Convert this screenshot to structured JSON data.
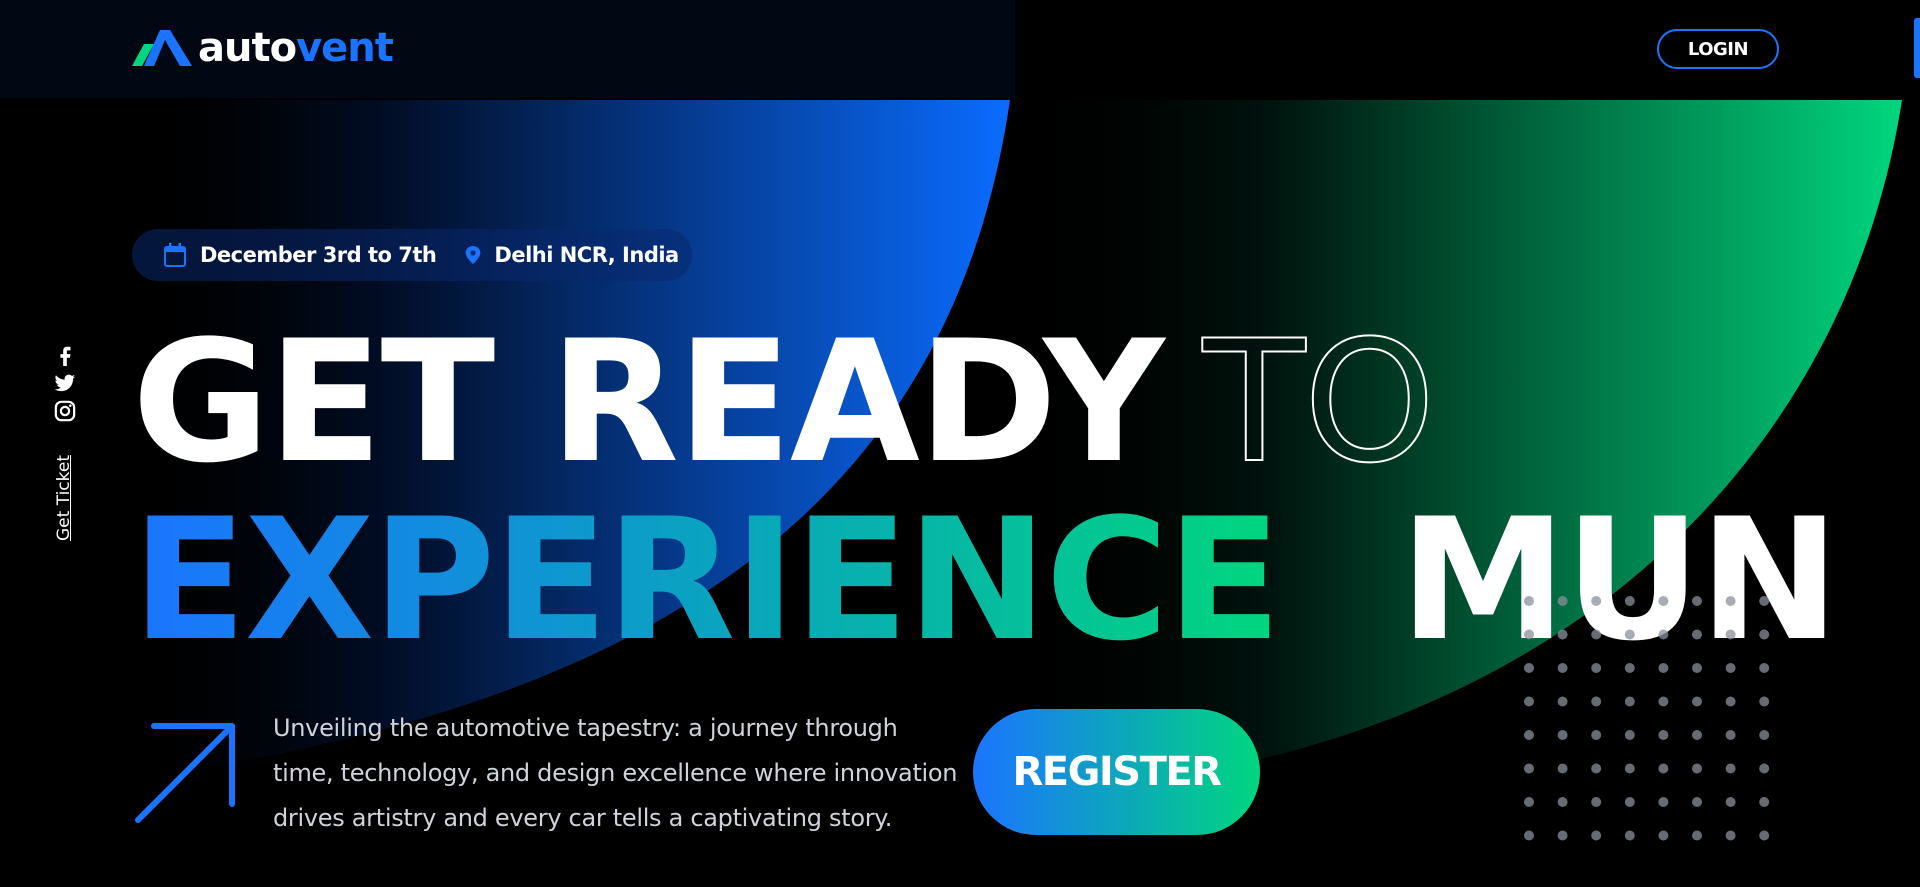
{
  "brand": {
    "name_part1": "auto",
    "name_part2": "vent",
    "primary_color": "#1b74ff",
    "accent_color": "#00d67e"
  },
  "header": {
    "login_label": "LOGIN"
  },
  "event": {
    "date": "December 3rd to 7th",
    "date_icon": "calendar-icon",
    "location": "Delhi NCR, India",
    "location_icon": "map-pin-icon"
  },
  "social": {
    "items": [
      {
        "icon": "facebook-icon"
      },
      {
        "icon": "twitter-icon"
      },
      {
        "icon": "instagram-icon"
      }
    ],
    "ticket_label": "Get Ticket"
  },
  "hero": {
    "line1_word1": "GET READY",
    "line1_word2": "TO",
    "line2_word1": "EXPERIENCE",
    "line2_word2": "MUN",
    "tagline": "Unveiling the automotive tapestry: a journey through time, technology, and design excellence where innovation drives artistry and every car tells a captivating story.",
    "register_label": "REGISTER"
  }
}
